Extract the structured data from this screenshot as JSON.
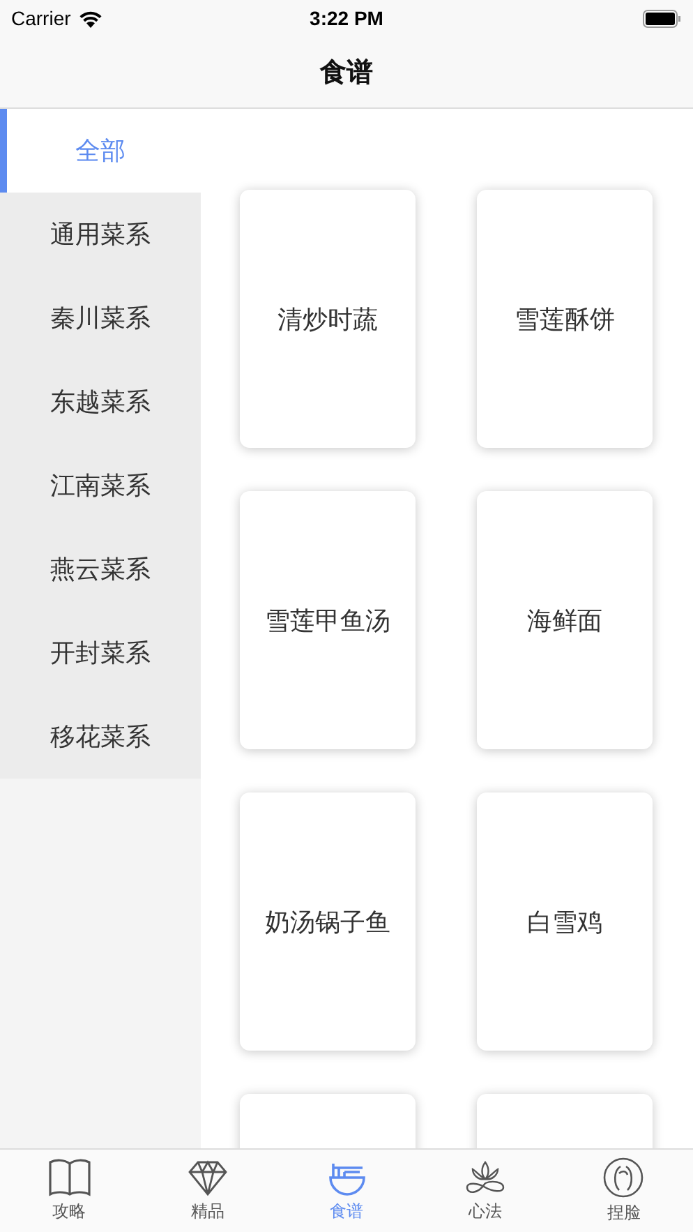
{
  "status_bar": {
    "carrier": "Carrier",
    "time": "3:22 PM"
  },
  "nav_bar": {
    "title": "食谱"
  },
  "sidebar": {
    "items": [
      {
        "label": "全部",
        "selected": true
      },
      {
        "label": "通用菜系",
        "selected": false
      },
      {
        "label": "秦川菜系",
        "selected": false
      },
      {
        "label": "东越菜系",
        "selected": false
      },
      {
        "label": "江南菜系",
        "selected": false
      },
      {
        "label": "燕云菜系",
        "selected": false
      },
      {
        "label": "开封菜系",
        "selected": false
      },
      {
        "label": "移花菜系",
        "selected": false
      }
    ]
  },
  "recipes": [
    {
      "kind": "card",
      "name": "清炒时蔬"
    },
    {
      "kind": "card",
      "name": "雪莲酥饼"
    },
    {
      "kind": "card",
      "name": "雪莲甲鱼汤"
    },
    {
      "kind": "card",
      "name": "海鲜面"
    },
    {
      "kind": "card",
      "name": "奶汤锅子鱼"
    },
    {
      "kind": "card",
      "name": "白雪鸡"
    },
    {
      "kind": "partial"
    },
    {
      "kind": "partial"
    }
  ],
  "tab_bar": [
    {
      "label": "攻略",
      "selected": false
    },
    {
      "label": "精品",
      "selected": false
    },
    {
      "label": "食谱",
      "selected": true
    },
    {
      "label": "心法",
      "selected": false
    },
    {
      "label": "捏脸",
      "selected": false
    }
  ]
}
